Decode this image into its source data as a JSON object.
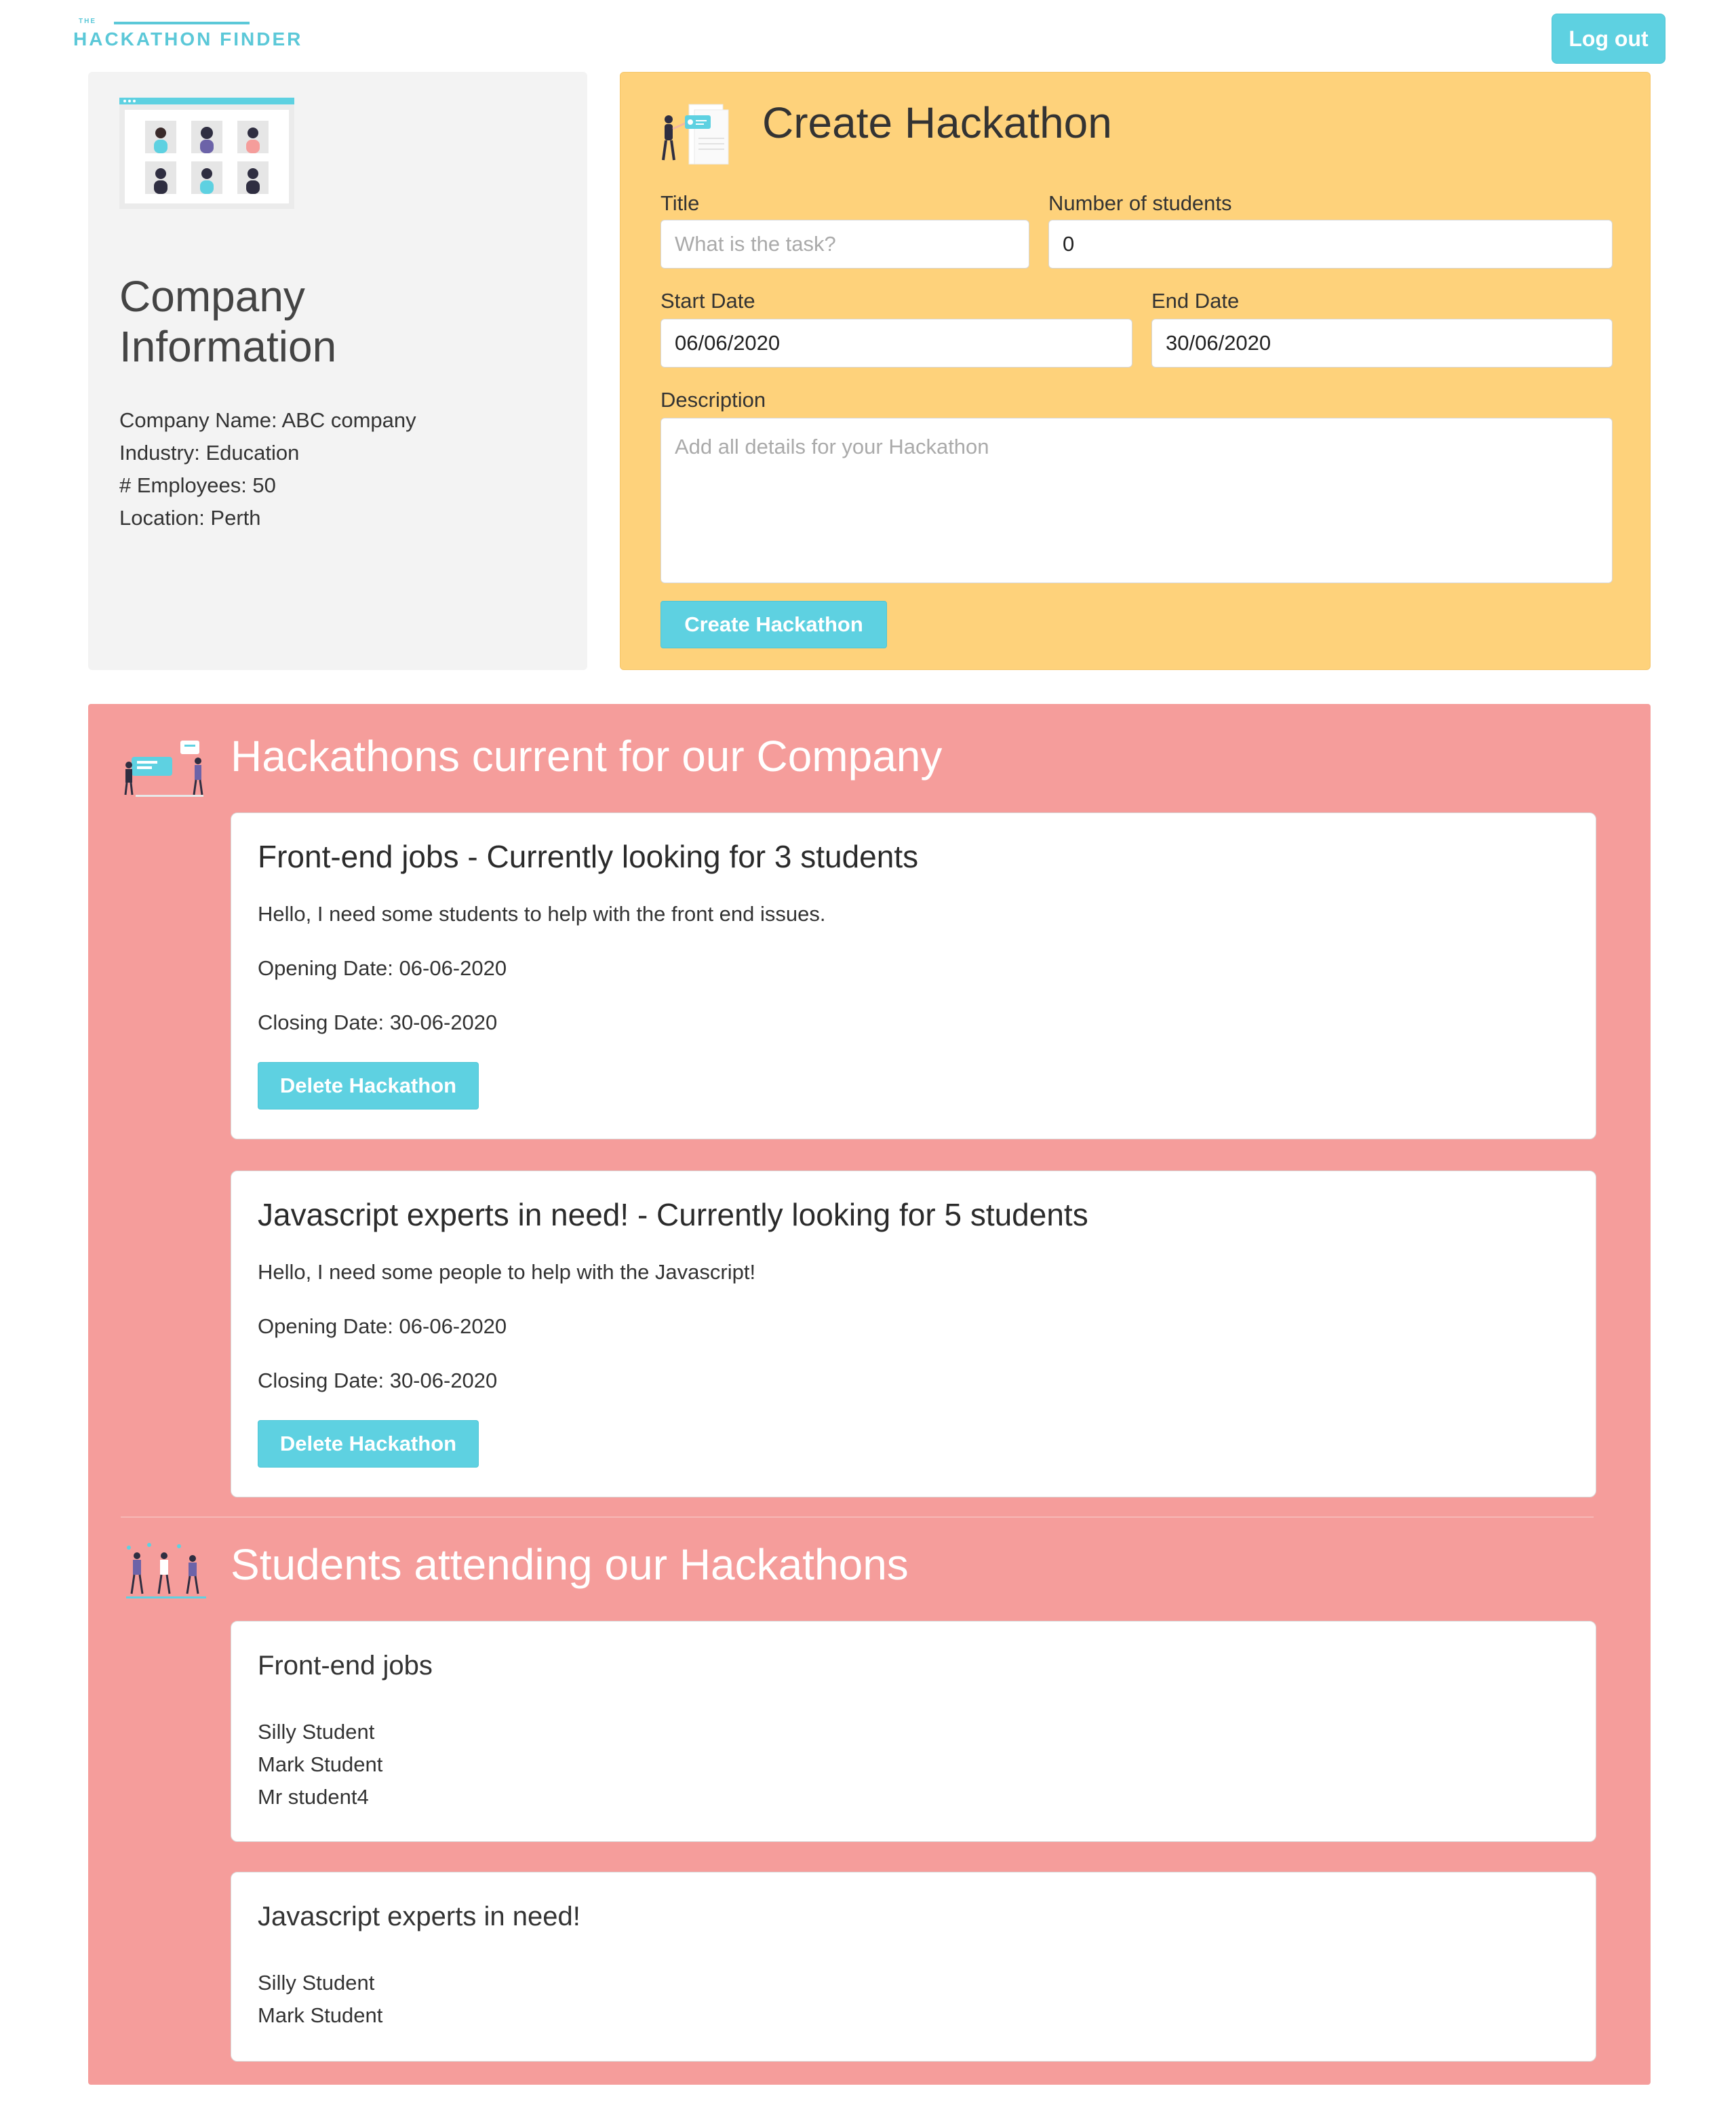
{
  "header": {
    "logo_small": "THE",
    "logo_main": "HACKATHON FINDER",
    "logout_label": "Log out"
  },
  "company": {
    "title": "Company Information",
    "name_line": "Company Name: ABC company",
    "industry_line": "Industry: Education",
    "employees_line": "# Employees: 50",
    "location_line": "Location: Perth"
  },
  "create_form": {
    "heading": "Create Hackathon",
    "title_label": "Title",
    "title_placeholder": "What is the task?",
    "students_label": "Number of students",
    "students_value": "0",
    "start_label": "Start Date",
    "start_value": "06/06/2020",
    "end_label": "End Date",
    "end_value": "30/06/2020",
    "description_label": "Description",
    "description_placeholder": "Add all details for your Hackathon",
    "submit_label": "Create Hackathon"
  },
  "current": {
    "heading": "Hackathons current for our Company",
    "hackathons": [
      {
        "title": "Front-end jobs - Currently looking for 3 students",
        "description": "Hello, I need some students to help with the front end issues.",
        "opening": "Opening Date: 06-06-2020",
        "closing": "Closing Date: 30-06-2020",
        "delete_label": "Delete Hackathon"
      },
      {
        "title": "Javascript experts in need! - Currently looking for 5 students",
        "description": "Hello, I need some people to help with the Javascript!",
        "opening": "Opening Date: 06-06-2020",
        "closing": "Closing Date: 30-06-2020",
        "delete_label": "Delete Hackathon"
      }
    ]
  },
  "attending": {
    "heading": "Students attending our Hackathons",
    "groups": [
      {
        "title": "Front-end jobs",
        "students": [
          "Silly Student",
          "Mark Student",
          "Mr student4"
        ]
      },
      {
        "title": "Javascript experts in need!",
        "students": [
          "Silly Student",
          "Mark Student"
        ]
      }
    ]
  },
  "colors": {
    "accent": "#5ed1e1",
    "create_panel": "#fed27b",
    "company_panel": "#f3f3f3",
    "section_bg": "#f59d9b"
  }
}
